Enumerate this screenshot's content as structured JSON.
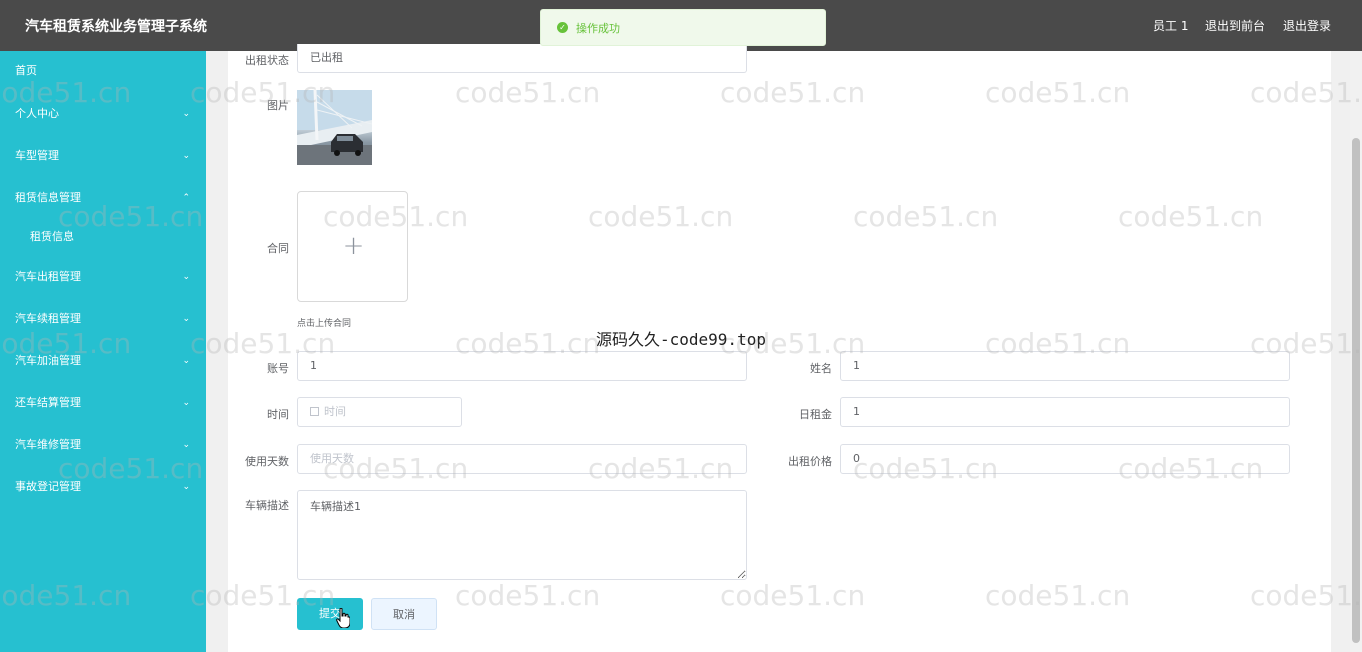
{
  "header": {
    "title": "汽车租赁系统业务管理子系统",
    "user": "员工 1",
    "to_front": "退出到前台",
    "logout": "退出登录"
  },
  "toast": {
    "message": "操作成功",
    "type": "success"
  },
  "sidebar": {
    "items": [
      {
        "label": "首页",
        "chevron": ""
      },
      {
        "label": "个人中心",
        "chevron": "⌄"
      },
      {
        "label": "车型管理",
        "chevron": "⌄"
      },
      {
        "label": "租赁信息管理",
        "chevron": "⌃"
      },
      {
        "label": "租赁信息",
        "chevron": ""
      },
      {
        "label": "汽车出租管理",
        "chevron": "⌄"
      },
      {
        "label": "汽车续租管理",
        "chevron": "⌄"
      },
      {
        "label": "汽车加油管理",
        "chevron": "⌄"
      },
      {
        "label": "还车结算管理",
        "chevron": "⌄"
      },
      {
        "label": "汽车维修管理",
        "chevron": "⌄"
      },
      {
        "label": "事故登记管理",
        "chevron": "⌄"
      }
    ]
  },
  "form": {
    "status": {
      "label": "出租状态",
      "value": "已出租"
    },
    "image": {
      "label": "图片"
    },
    "contract": {
      "label": "合同",
      "upload_hint": "点击上传合同",
      "plus": "+"
    },
    "account": {
      "label": "账号",
      "value": "1"
    },
    "name": {
      "label": "姓名",
      "value": "1"
    },
    "time": {
      "label": "时间",
      "placeholder": "时间"
    },
    "daily_rent": {
      "label": "日租金",
      "value": "1"
    },
    "days": {
      "label": "使用天数",
      "placeholder": "使用天数"
    },
    "price": {
      "label": "出租价格",
      "value": "0"
    },
    "description": {
      "label": "车辆描述",
      "value": "车辆描述1"
    },
    "submit": "提交",
    "cancel": "取消"
  },
  "watermarks": {
    "text": "code51.cn",
    "center_text": "源码久久-code99.top"
  },
  "colors": {
    "sidebar": "#26c0d0",
    "header": "#4a4a4a",
    "success": "#67c23a"
  }
}
